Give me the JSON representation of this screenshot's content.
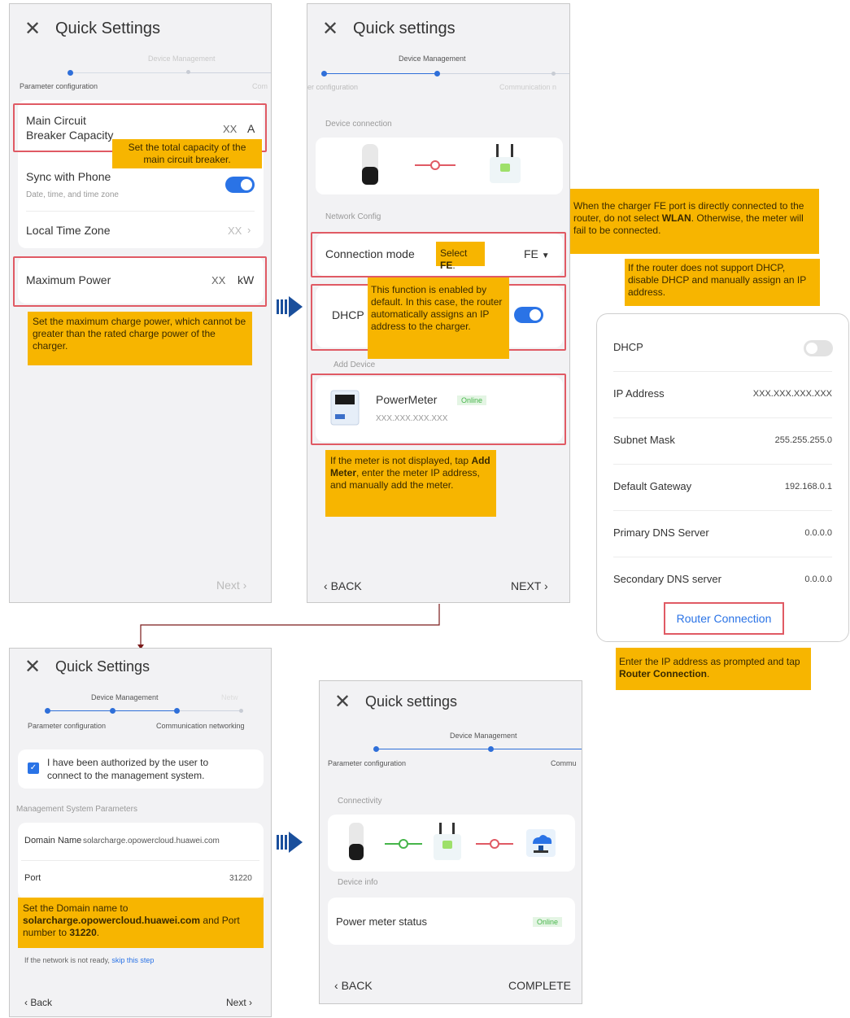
{
  "phone1": {
    "title": "Quick Settings",
    "step_top": "Device Management",
    "step_left": "Parameter configuration",
    "step_right": "Com",
    "main_circuit_label": "Main Circuit Breaker Capacity",
    "main_circuit_value": "XX",
    "main_circuit_unit": "A",
    "note_capacity": "Set the total capacity of the main circuit breaker.",
    "sync_label": "Sync with Phone",
    "sync_sub": "Date, time, and time zone",
    "timezone_label": "Local Time Zone",
    "timezone_value": "XX",
    "max_power_label": "Maximum Power",
    "max_power_value": "XX",
    "max_power_unit": "kW",
    "note_max_power": "Set the maximum charge power, which cannot be greater than the rated charge power of the charger.",
    "next": "Next"
  },
  "phone2": {
    "title": "Quick settings",
    "step_top": "Device Management",
    "step_left": "er configuration",
    "step_right": "Communication n",
    "device_connection": "Device connection",
    "network_config": "Network Config",
    "connection_mode_label": "Connection mode",
    "connection_mode_note_prefix": "Select ",
    "connection_mode_note_bold": "FE",
    "connection_mode_note_suffix": ".",
    "connection_mode_value": "FE",
    "dhcp_label": "DHCP",
    "note_dhcp": "This function is enabled by default. In this case, the router automatically assigns an IP address to the charger.",
    "add_device": "Add Device",
    "meter_name": "PowerMeter",
    "meter_status": "Online",
    "meter_ip": "XXX.XXX.XXX.XXX",
    "note_meter_a": "If the meter is not displayed, tap ",
    "note_meter_b": "Add Meter",
    "note_meter_c": ", enter the meter IP address, and manually add the meter.",
    "back": "BACK",
    "next": "NEXT"
  },
  "side_notes": {
    "fe_a": "When the charger FE port is directly connected to the router, do not select ",
    "fe_b": "WLAN",
    "fe_c": ". Otherwise, the meter will fail to be connected.",
    "dhcp": "If the router does not support DHCP, disable DHCP and manually assign an IP address.",
    "router_a": "Enter the IP address as prompted and tap ",
    "router_b": "Router Connection",
    "router_c": "."
  },
  "dhcp_panel": {
    "rows": [
      {
        "label": "DHCP",
        "value": ""
      },
      {
        "label": "IP Address",
        "value": "XXX.XXX.XXX.XXX"
      },
      {
        "label": "Subnet Mask",
        "value": "255.255.255.0"
      },
      {
        "label": "Default Gateway",
        "value": "192.168.0.1"
      },
      {
        "label": "Primary DNS Server",
        "value": "0.0.0.0"
      },
      {
        "label": "Secondary DNS server",
        "value": "0.0.0.0"
      }
    ],
    "router_button": "Router Connection"
  },
  "phone3": {
    "title": "Quick Settings",
    "step_top": "Device Management",
    "step_hidden": "Netw",
    "step_left": "Parameter configuration",
    "step_right": "Communication networking",
    "auth_text": "I have been authorized by the user to connect to the management system.",
    "section": "Management System Parameters",
    "domain_label": "Domain Name",
    "domain_value": "solarcharge.opowercloud.huawei.com",
    "port_label": "Port",
    "port_value": "31220",
    "note_a": "Set the Domain name to ",
    "note_b": "solarcharge.opowercloud.huawei.com",
    "note_c": " and Port number to ",
    "note_d": "31220",
    "note_e": ".",
    "network_hint": "If the network is not ready, ",
    "skip_link": "skip this step",
    "back": "Back",
    "next": "Next"
  },
  "phone4": {
    "title": "Quick settings",
    "step_top": "Device Management",
    "step_left": "Parameter configuration",
    "step_right": "Commu",
    "connectivity": "Connectivity",
    "device_info": "Device info",
    "meter_status_label": "Power meter status",
    "meter_status_value": "Online",
    "back": "BACK",
    "complete": "COMPLETE"
  },
  "colors": {
    "accent": "#2a73e6",
    "note": "#f7b500",
    "highlight": "#e05a64",
    "online": "#46b54a"
  }
}
